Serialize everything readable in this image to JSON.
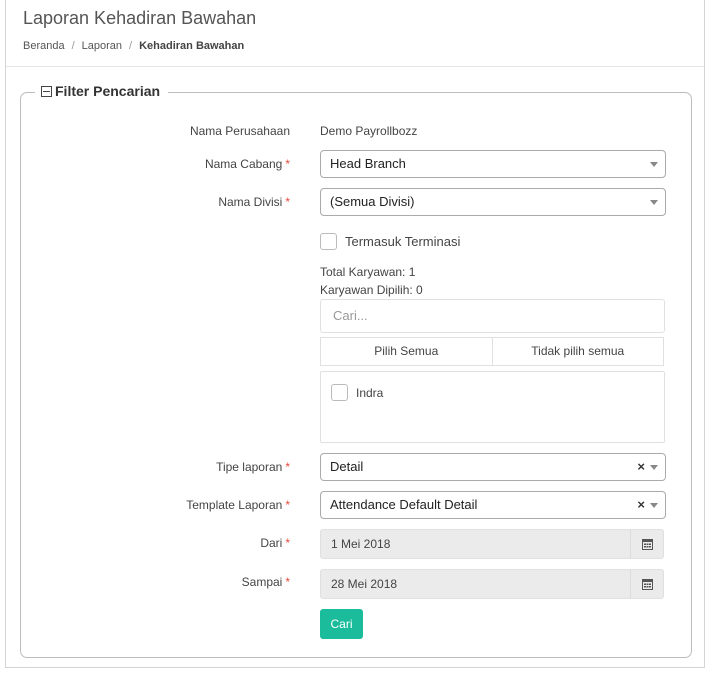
{
  "page": {
    "title": "Laporan Kehadiran Bawahan",
    "breadcrumb": [
      "Beranda",
      "Laporan",
      "Kehadiran Bawahan"
    ]
  },
  "filter": {
    "legend": "Filter Pencarian",
    "company": {
      "label": "Nama Perusahaan",
      "value": "Demo Payrollbozz"
    },
    "branch": {
      "label": "Nama Cabang",
      "value": "Head Branch"
    },
    "division": {
      "label": "Nama Divisi",
      "value": "(Semua Divisi)"
    },
    "include_termination": {
      "label": "Termasuk Terminasi",
      "checked": false
    },
    "total_employees": "Total Karyawan: 1",
    "selected_employees": "Karyawan Dipilih: 0",
    "employee_search": {
      "placeholder": "Cari..."
    },
    "select_all": "Pilih Semua",
    "deselect_all": "Tidak pilih semua",
    "employees": [
      {
        "name": "Indra",
        "checked": false
      }
    ],
    "report_type": {
      "label": "Tipe laporan",
      "value": "Detail"
    },
    "report_template": {
      "label": "Template Laporan",
      "value": "Attendance Default Detail"
    },
    "date_from": {
      "label": "Dari",
      "value": "1 Mei 2018"
    },
    "date_to": {
      "label": "Sampai",
      "value": "28 Mei 2018"
    },
    "submit": "Cari",
    "required_mark": "*",
    "clear_mark": "×"
  },
  "colors": {
    "accent": "#1abc9c",
    "required": "#e74c3c",
    "disabled_bg": "#ebebeb"
  },
  "icons": [
    "collapse-icon",
    "chevron-down-icon",
    "clear-icon",
    "calendar-icon"
  ]
}
